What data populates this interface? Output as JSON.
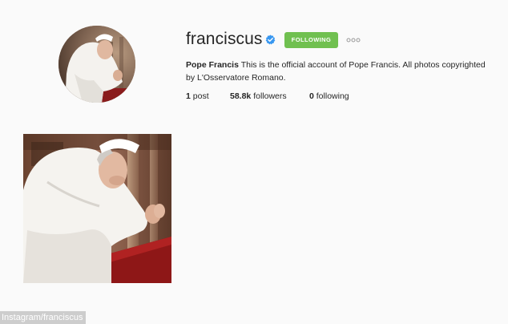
{
  "profile": {
    "username": "franciscus",
    "full_name": "Pope Francis",
    "bio": "This is the official account of Pope Francis. All photos copyrighted by L'Osservatore Romano.",
    "verified": true
  },
  "actions": {
    "follow_label": "FOLLOWING"
  },
  "stats": {
    "posts_count": "1",
    "posts_label": "post",
    "followers_count": "58.8k",
    "followers_label": "followers",
    "following_count": "0",
    "following_label": "following"
  },
  "credit": "Instagram/franciscus",
  "colors": {
    "background": "#fafafa",
    "following_button": "#70c050",
    "verified_badge": "#3897f0",
    "text": "#262626"
  },
  "icons": {
    "verified": "verified-badge-icon",
    "more": "more-options-icon"
  }
}
